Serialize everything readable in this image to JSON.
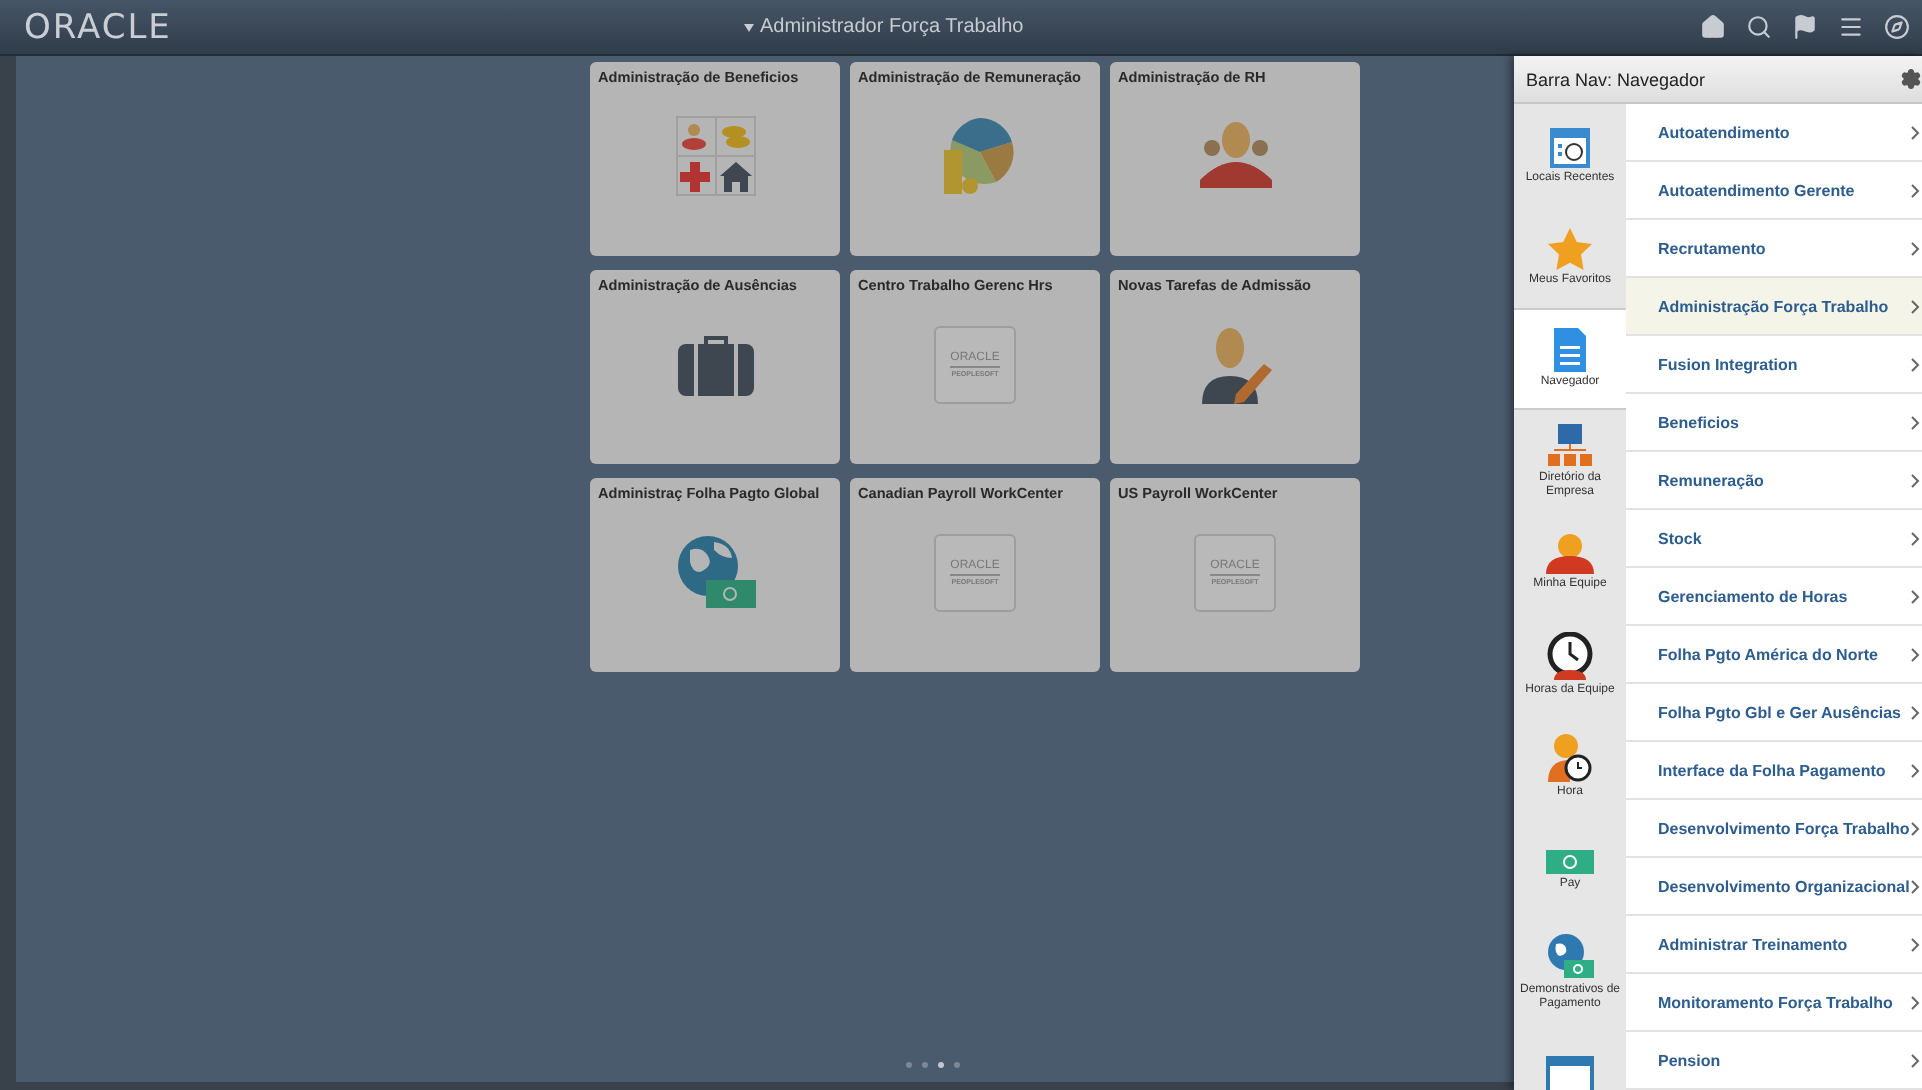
{
  "header": {
    "logo": "ORACLE",
    "title": "Administrador Força Trabalho"
  },
  "tiles": [
    {
      "title": "Administração de Beneficios",
      "kind": "benefits"
    },
    {
      "title": "Administração de Remuneração",
      "kind": "pie"
    },
    {
      "title": "Administração de RH",
      "kind": "group"
    },
    {
      "title": "Administração de Ausências",
      "kind": "briefcase"
    },
    {
      "title": "Centro Trabalho Gerenc Hrs",
      "kind": "logo",
      "logo": [
        "ORACLE",
        "PEOPLESOFT"
      ]
    },
    {
      "title": "Novas Tarefas de Admissão",
      "kind": "person-pencil"
    },
    {
      "title": "Administraç Folha Pagto Global",
      "kind": "globe-money"
    },
    {
      "title": "Canadian Payroll WorkCenter",
      "kind": "logo",
      "logo": [
        "ORACLE",
        "PEOPLESOFT"
      ]
    },
    {
      "title": "US Payroll WorkCenter",
      "kind": "logo",
      "logo": [
        "ORACLE",
        "PEOPLESOFT"
      ]
    }
  ],
  "pager": [
    {
      "selected": false
    },
    {
      "selected": false
    },
    {
      "selected": true
    },
    {
      "selected": false
    }
  ],
  "nav": {
    "title": "Barra Nav: Navegador",
    "sidebar": [
      {
        "label": "Locais Recentes",
        "kind": "calendar",
        "selected": false
      },
      {
        "label": "Meus Favoritos",
        "kind": "star",
        "selected": false
      },
      {
        "label": "Navegador",
        "kind": "document",
        "selected": true
      },
      {
        "label": "Diretório da Empresa",
        "kind": "org",
        "selected": false
      },
      {
        "label": "Minha Equipe",
        "kind": "team",
        "selected": false
      },
      {
        "label": "Horas da Equipe",
        "kind": "clock",
        "selected": false
      },
      {
        "label": "Hora",
        "kind": "person-clock",
        "selected": false
      },
      {
        "label": "Pay",
        "kind": "money",
        "selected": false
      },
      {
        "label": "Demonstrativos de Pagamento",
        "kind": "globe-money",
        "selected": false
      },
      {
        "kind": "window",
        "selected": false
      }
    ],
    "items": [
      {
        "label": "Autoatendimento",
        "selected": false
      },
      {
        "label": "Autoatendimento Gerente",
        "selected": false
      },
      {
        "label": "Recrutamento",
        "selected": false
      },
      {
        "label": "Administração Força Trabalho",
        "selected": true
      },
      {
        "label": "Fusion Integration",
        "selected": false
      },
      {
        "label": "Beneficios",
        "selected": false
      },
      {
        "label": "Remuneração",
        "selected": false
      },
      {
        "label": "Stock",
        "selected": false
      },
      {
        "label": "Gerenciamento de Horas",
        "selected": false
      },
      {
        "label": "Folha Pgto América do Norte",
        "selected": false
      },
      {
        "label": "Folha Pgto Gbl e Ger Ausências",
        "selected": false
      },
      {
        "label": "Interface da Folha Pagamento",
        "selected": false
      },
      {
        "label": "Desenvolvimento Força Trabalho",
        "selected": false
      },
      {
        "label": "Desenvolvimento Organizacional",
        "selected": false
      },
      {
        "label": "Administrar Treinamento",
        "selected": false
      },
      {
        "label": "Monitoramento Força Trabalho",
        "selected": false
      },
      {
        "label": "Pension",
        "selected": false
      }
    ]
  }
}
